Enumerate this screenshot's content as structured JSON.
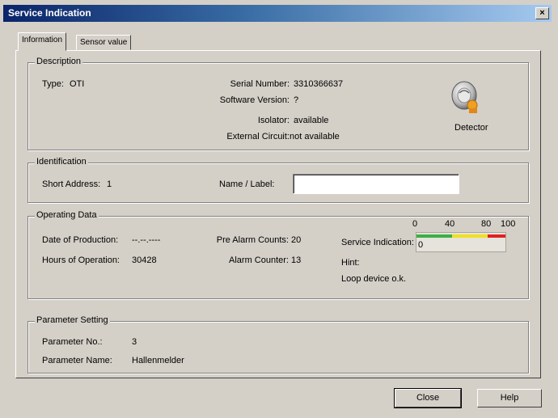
{
  "window": {
    "title": "Service Indication",
    "close_glyph": "×"
  },
  "tabs": [
    {
      "label": "Information",
      "active": true
    },
    {
      "label": "Sensor value",
      "active": false
    }
  ],
  "description": {
    "legend": "Description",
    "type_label": "Type:",
    "type_value": "OTI",
    "serial_label": "Serial Number:",
    "serial_value": "3310366637",
    "software_label": "Software Version:",
    "software_value": "?",
    "isolator_label": "Isolator:",
    "isolator_value": "available",
    "external_label": "External Circuit:",
    "external_value": "not available",
    "detector_label": "Detector",
    "detector_icon": "smoke-detector-icon"
  },
  "identification": {
    "legend": "Identification",
    "short_address_label": "Short Address:",
    "short_address_value": "1",
    "name_label": "Name / Label:",
    "name_value": ""
  },
  "operating": {
    "legend": "Operating Data",
    "production_label": "Date of Production:",
    "production_value": "--.--.----",
    "hours_label": "Hours of Operation:",
    "hours_value": "30428",
    "prealarm_label": "Pre Alarm Counts:",
    "prealarm_value": "20",
    "alarm_label": "Alarm Counter:",
    "alarm_value": "13",
    "service_label": "Service Indication:",
    "service_value": "0",
    "scale_0": "0",
    "scale_40": "40",
    "scale_80": "80",
    "scale_100": "100",
    "hint_label": "Hint:",
    "hint_value": "Loop device o.k.",
    "colors": {
      "green": "#3cb043",
      "yellow": "#f0e020",
      "red": "#e02020"
    }
  },
  "parameter": {
    "legend": "Parameter Setting",
    "no_label": "Parameter No.:",
    "no_value": "3",
    "name_label": "Parameter Name:",
    "name_value": "Hallenmelder"
  },
  "buttons": {
    "close": "Close",
    "help": "Help"
  }
}
